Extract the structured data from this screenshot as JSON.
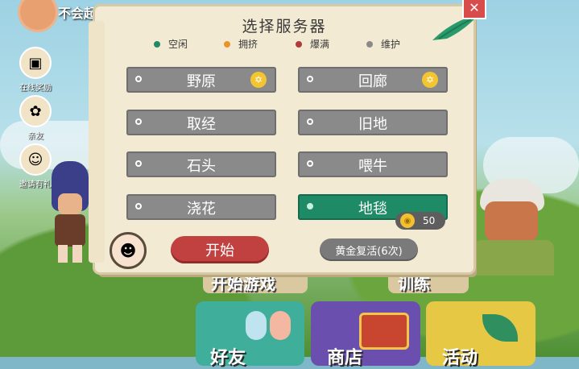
{
  "hud": {
    "player_name": "不会起",
    "side_buttons": [
      {
        "label": "在线奖励",
        "icon": "treasure-chest-icon"
      },
      {
        "label": "亲友",
        "icon": "flower-icon"
      },
      {
        "label": "邀请有礼",
        "icon": "people-icon"
      }
    ]
  },
  "bottom_menu": {
    "behind": [
      "开始游戏",
      "训练"
    ],
    "cards": [
      {
        "label": "好友",
        "icon": "friends-icon"
      },
      {
        "label": "商店",
        "icon": "chest-icon"
      },
      {
        "label": "活动",
        "icon": "leaf-icon"
      }
    ]
  },
  "dialog": {
    "title": "选择服务器",
    "close_label": "✕",
    "legend": [
      {
        "label": "空闲",
        "color": "#1e8a66"
      },
      {
        "label": "拥挤",
        "color": "#e8942a"
      },
      {
        "label": "爆满",
        "color": "#b23a3a"
      },
      {
        "label": "维护",
        "color": "#8a8a8a"
      }
    ],
    "servers": [
      {
        "label": "野原",
        "recommended": true,
        "selected": false
      },
      {
        "label": "回廊",
        "recommended": true,
        "selected": false
      },
      {
        "label": "取经",
        "recommended": false,
        "selected": false
      },
      {
        "label": "旧地",
        "recommended": false,
        "selected": false
      },
      {
        "label": "石头",
        "recommended": false,
        "selected": false
      },
      {
        "label": "喂牛",
        "recommended": false,
        "selected": false
      },
      {
        "label": "浇花",
        "recommended": false,
        "selected": false
      },
      {
        "label": "地毯",
        "recommended": false,
        "selected": true
      }
    ],
    "cost": "50",
    "start_label": "开始",
    "revive_label": "黄金复活(6次)"
  }
}
